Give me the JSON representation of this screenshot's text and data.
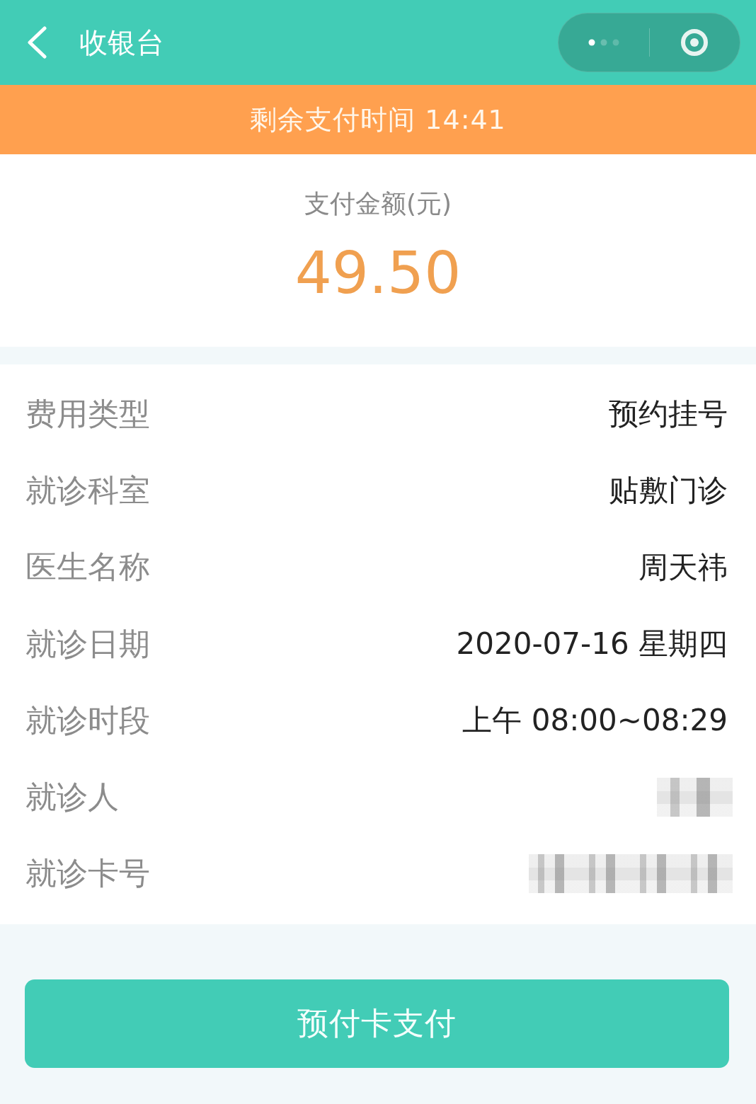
{
  "header": {
    "title": "收银台"
  },
  "countdown": {
    "text": "剩余支付时间 14:41"
  },
  "amount": {
    "label": "支付金额(元)",
    "value": "49.50"
  },
  "details": [
    {
      "kind": "text",
      "label": "费用类型",
      "value": "预约挂号"
    },
    {
      "kind": "text",
      "label": "就诊科室",
      "value": "贴敷门诊"
    },
    {
      "kind": "text",
      "label": "医生名称",
      "value": "周天祎"
    },
    {
      "kind": "text",
      "label": "就诊日期",
      "value": "2020-07-16 星期四"
    },
    {
      "kind": "text",
      "label": "就诊时段",
      "value": "上午 08:00~08:29"
    },
    {
      "kind": "masked",
      "label": "就诊人",
      "wide": false
    },
    {
      "kind": "masked",
      "label": "就诊卡号",
      "wide": true
    }
  ],
  "pay_button": {
    "label": "预付卡支付"
  }
}
